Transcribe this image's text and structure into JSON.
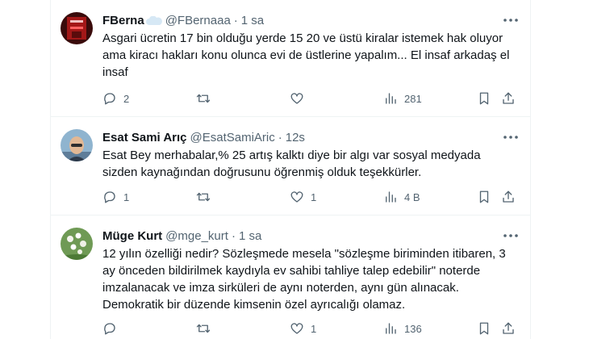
{
  "tweets": [
    {
      "name": "FBerna",
      "handle": "@FBernaaa",
      "separator": "·",
      "time": "1 sa",
      "lines": [
        "Asgari ücretin 17 bin olduğu yerde 15 20 ve üstü kiralar istemek hak oluyor",
        "ama kiracı hakları konu olunca evi de üstlerine yapalım... El insaf arkadaş el",
        "insaf"
      ],
      "replies": "2",
      "retweets": "",
      "likes": "",
      "views": "281"
    },
    {
      "name": "Esat Sami Arıç",
      "handle": "@EsatSamiAric",
      "separator": "·",
      "time": "12s",
      "lines": [
        "Esat Bey merhabalar,% 25 artış  kalktı diye bir algı var sosyal medyada",
        "sizden kaynağından doğrusunu öğrenmiş olduk teşekkürler."
      ],
      "replies": "1",
      "retweets": "",
      "likes": "1",
      "views": "4 B"
    },
    {
      "name": "Müge Kurt",
      "handle": "@mge_kurt",
      "separator": "·",
      "time": "1 sa",
      "lines": [
        "12 yılın özelliği nedir? Sözleşmede mesela \"sözleşme biriminden itibaren, 3",
        "ay önceden bildirilmek kaydıyla ev sahibi tahliye talep edebilir\" noterde",
        "imzalanacak ve imza sirküleri de aynı noterden, aynı gün alınacak.",
        "Demokratik bir düzende kimsenin özel ayrıcalığı olamaz."
      ],
      "replies": "",
      "retweets": "",
      "likes": "1",
      "views": "136"
    }
  ],
  "icons": {
    "more": "more-dots-icon",
    "reply": "reply-bubble-icon",
    "retweet": "retweet-icon",
    "like": "heart-icon",
    "views": "bar-chart-icon",
    "bookmark": "bookmark-icon",
    "share": "share-upload-icon",
    "badge": "cloud-emoji-icon"
  },
  "colors": {
    "text": "#0f1419",
    "secondary": "#536471",
    "divider": "#eff3f4"
  }
}
